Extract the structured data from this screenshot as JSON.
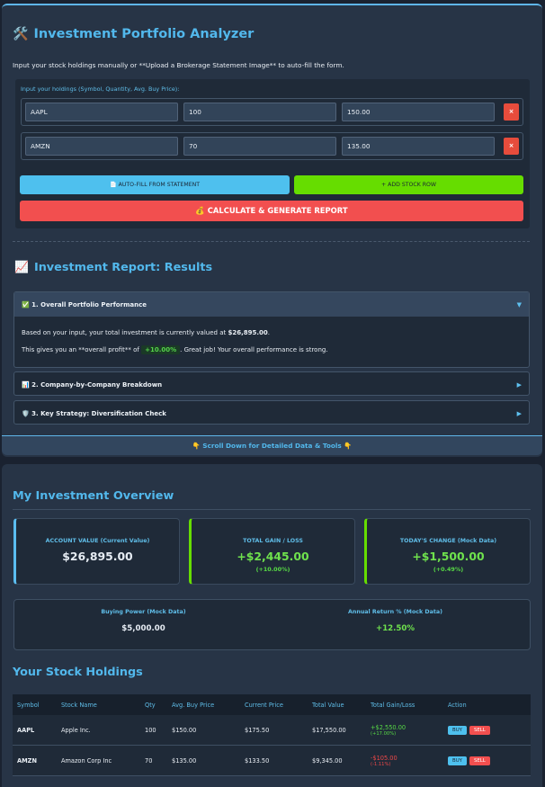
{
  "analyzer": {
    "title": "Investment Portfolio Analyzer",
    "title_icon": "🛠️",
    "intro": "Input your stock holdings manually or **Upload a Brokerage Statement Image** to auto-fill the form.",
    "input_label": "Input your holdings (Symbol, Quantity, Avg. Buy Price):",
    "rows": [
      {
        "symbol": "AAPL",
        "qty": "100",
        "price": "150.00",
        "remove": "×"
      },
      {
        "symbol": "AMZN",
        "qty": "70",
        "price": "135.00",
        "remove": "×"
      }
    ],
    "autofill_label": "📄 AUTO-FILL FROM STATEMENT",
    "add_label": "+ ADD STOCK ROW",
    "calc_label": "💰 CALCULATE & GENERATE REPORT"
  },
  "report": {
    "title": "Investment Report: Results",
    "title_icon": "📈",
    "sections": [
      {
        "label": "1. Overall Portfolio Performance",
        "icon": "✅",
        "arrow": "▼"
      },
      {
        "label": "2. Company-by-Company Breakdown",
        "icon": "📊",
        "arrow": "▶"
      },
      {
        "label": "3. Key Strategy: Diversification Check",
        "icon": "🛡️",
        "arrow": "▶"
      }
    ],
    "body_line1_pre": "Based on your input, your total investment is currently valued at ",
    "body_value": "$26,895.00",
    "body_line1_post": ".",
    "body_line2_pre": "This gives you an **overall profit** of ",
    "body_profit": "+10.00%",
    "body_line2_post": ". Great job! Your overall performance is strong.",
    "scroll_hint": "👇 Scroll Down for Detailed Data & Tools 👇"
  },
  "overview": {
    "title": "My Investment Overview",
    "kpis": [
      {
        "label": "ACCOUNT VALUE (Current Value)",
        "value": "$26,895.00",
        "sub": ""
      },
      {
        "label": "TOTAL GAIN / LOSS",
        "value": "+$2,445.00",
        "sub": "(+10.00%)"
      },
      {
        "label": "TODAY'S CHANGE (Mock Data)",
        "value": "+$1,500.00",
        "sub": "(+0.49%)"
      }
    ],
    "buying_power_label": "Buying Power (Mock Data)",
    "buying_power_value": "$5,000.00",
    "annual_return_label": "Annual Return % (Mock Data)",
    "annual_return_value": "+12.50%"
  },
  "holdings": {
    "title": "Your Stock Holdings",
    "columns": [
      "Symbol",
      "Stock Name",
      "Qty",
      "Avg. Buy Price",
      "Current Price",
      "Total Value",
      "Total Gain/Loss",
      "Action"
    ],
    "rows": [
      {
        "symbol": "AAPL",
        "name": "Apple Inc.",
        "qty": "100",
        "avg": "$150.00",
        "current": "$175.50",
        "total": "$17,550.00",
        "gain": "+$2,550.00",
        "gain_pct": "(+17.00%)",
        "buy": "BUY",
        "sell": "SELL"
      },
      {
        "symbol": "AMZN",
        "name": "Amazon Corp Inc",
        "qty": "70",
        "avg": "$135.00",
        "current": "$133.50",
        "total": "$9,345.00",
        "gain": "-$105.00",
        "gain_pct": "(-1.11%)",
        "buy": "BUY",
        "sell": "SELL"
      }
    ]
  },
  "colors": {
    "accent": "#52b8ec",
    "positive": "#57d945",
    "negative": "#f04848",
    "add": "#66dd00",
    "danger": "#f24f4f"
  }
}
